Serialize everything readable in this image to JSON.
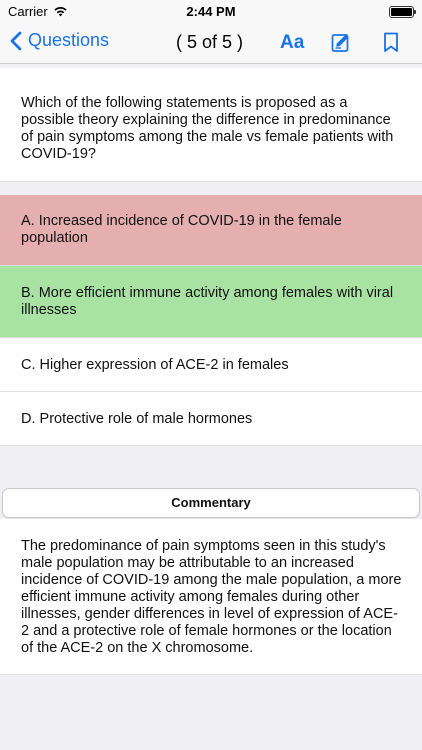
{
  "status_bar": {
    "carrier": "Carrier",
    "time": "2:44 PM",
    "icons": [
      "wifi-icon",
      "battery-icon"
    ]
  },
  "nav": {
    "back_label": "Questions",
    "counter": "( 5 of 5 )",
    "font_label": "Aa",
    "icons": [
      "chevron-left-icon",
      "edit-note-icon",
      "bookmark-icon"
    ],
    "accent_color": "#1a73e8"
  },
  "question": {
    "text": "Which of the following statements is proposed as a possible theory explaining the difference in predominance of pain symptoms among the male vs female patients with COVID-19?"
  },
  "answers": [
    {
      "label": "A. Increased incidence of COVID-19 in the female population",
      "state": "incorrect",
      "color": "#e5afaf"
    },
    {
      "label": "B. More efficient immune activity among females with viral illnesses",
      "state": "correct",
      "color": "#a9e3a4"
    },
    {
      "label": "C. Higher expression of ACE-2 in females",
      "state": "neutral",
      "color": "#ffffff"
    },
    {
      "label": "D. Protective role of male hormones",
      "state": "neutral",
      "color": "#ffffff"
    }
  ],
  "commentary": {
    "button_label": "Commentary",
    "text": "The predominance of pain symptoms seen in this study's male population may be attributable to an increased incidence of COVID-19 among the male population, a more efficient immune activity among females during other illnesses, gender differences in level of expression of ACE-2 and a protective role of female hormones or the location of the ACE-2 on the X chromosome."
  }
}
